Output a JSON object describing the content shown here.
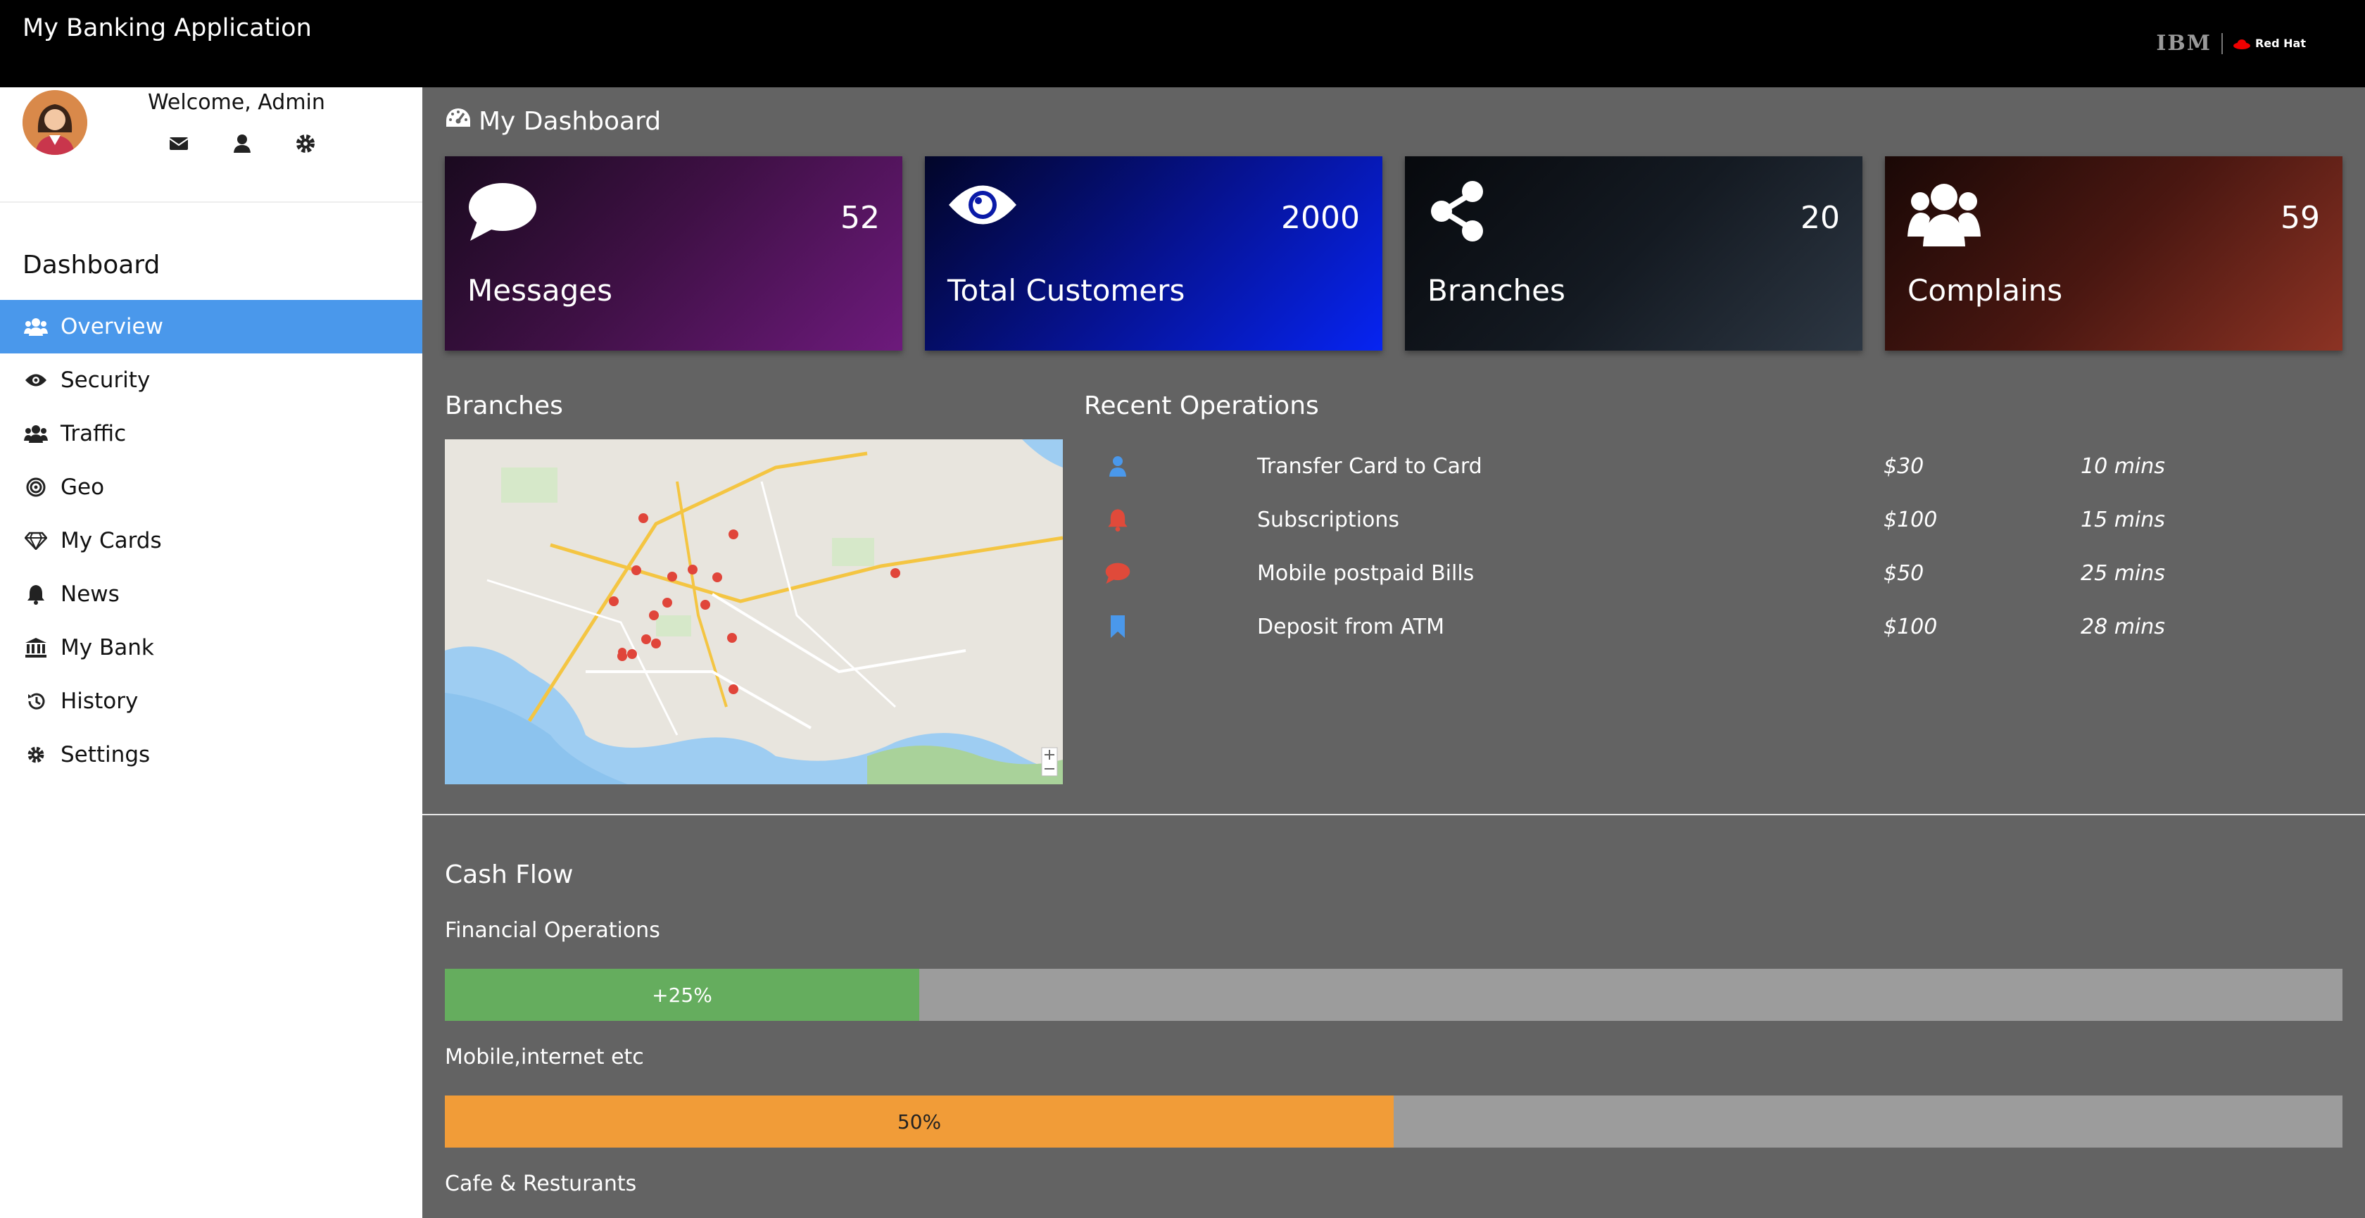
{
  "app": {
    "title": "My Banking Application"
  },
  "brand": {
    "ibm": "IBM",
    "redhat": "Red Hat"
  },
  "user": {
    "welcome": "Welcome, Admin"
  },
  "sidebar": {
    "heading": "Dashboard",
    "items": [
      {
        "label": "Overview",
        "icon": "users-icon",
        "active": true
      },
      {
        "label": "Security",
        "icon": "eye-icon"
      },
      {
        "label": "Traffic",
        "icon": "users-icon"
      },
      {
        "label": "Geo",
        "icon": "bullseye-icon"
      },
      {
        "label": "My Cards",
        "icon": "diamond-icon"
      },
      {
        "label": "News",
        "icon": "bell-icon"
      },
      {
        "label": "My Bank",
        "icon": "bank-icon"
      },
      {
        "label": "History",
        "icon": "history-icon"
      },
      {
        "label": "Settings",
        "icon": "gear-icon"
      }
    ]
  },
  "dashboard": {
    "title": "My Dashboard",
    "cards": [
      {
        "label": "Messages",
        "value": "52",
        "icon": "comment-icon"
      },
      {
        "label": "Total Customers",
        "value": "2000",
        "icon": "eye-icon"
      },
      {
        "label": "Branches",
        "value": "20",
        "icon": "share-icon"
      },
      {
        "label": "Complains",
        "value": "59",
        "icon": "users-icon"
      }
    ]
  },
  "branches": {
    "title": "Branches"
  },
  "operations": {
    "title": "Recent Operations",
    "rows": [
      {
        "icon": "user-icon",
        "color": "#4a98eb",
        "name": "Transfer Card to Card",
        "amount": "$30",
        "time": "10 mins"
      },
      {
        "icon": "bell-icon",
        "color": "#e04a3a",
        "name": "Subscriptions",
        "amount": "$100",
        "time": "15 mins"
      },
      {
        "icon": "comment-icon",
        "color": "#e04a3a",
        "name": "Mobile postpaid Bills",
        "amount": "$50",
        "time": "25 mins"
      },
      {
        "icon": "bookmark-icon",
        "color": "#4a98eb",
        "name": "Deposit from ATM",
        "amount": "$100",
        "time": "28 mins"
      }
    ]
  },
  "cashflow": {
    "title": "Cash Flow",
    "bars": [
      {
        "label": "Financial Operations",
        "text": "+25%",
        "fraction": 0.25,
        "color": "#65ad5e"
      },
      {
        "label": "Mobile,internet etc",
        "text": "50%",
        "fraction": 0.5,
        "color": "#f19c38"
      },
      {
        "label": "Cafe & Resturants"
      }
    ]
  }
}
